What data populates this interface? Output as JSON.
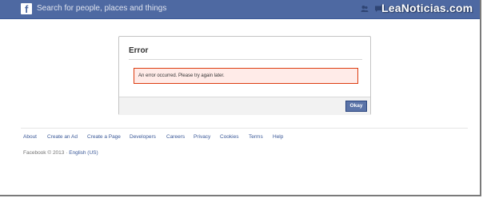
{
  "topbar": {
    "logo_letter": "f",
    "search_placeholder": "Search for people, places and things",
    "watermark": "LeaNoticias.com",
    "icons": [
      "friend-requests-icon",
      "messages-icon",
      "notifications-icon"
    ],
    "background_color": "#4e69a2"
  },
  "dialog": {
    "title": "Error",
    "error_message": "An error occurred. Please try again later.",
    "okay_label": "Okay"
  },
  "footer": {
    "links": [
      "About",
      "Create an Ad",
      "Create a Page",
      "Developers",
      "Careers",
      "Privacy",
      "Cookies",
      "Terms",
      "Help"
    ],
    "copyright": "Facebook © 2013 · ",
    "language": "English (US)"
  },
  "colors": {
    "link": "#3b5998",
    "error_border": "#dd3c10",
    "error_bg": "#ffebe8",
    "button": "#5b74a8"
  }
}
